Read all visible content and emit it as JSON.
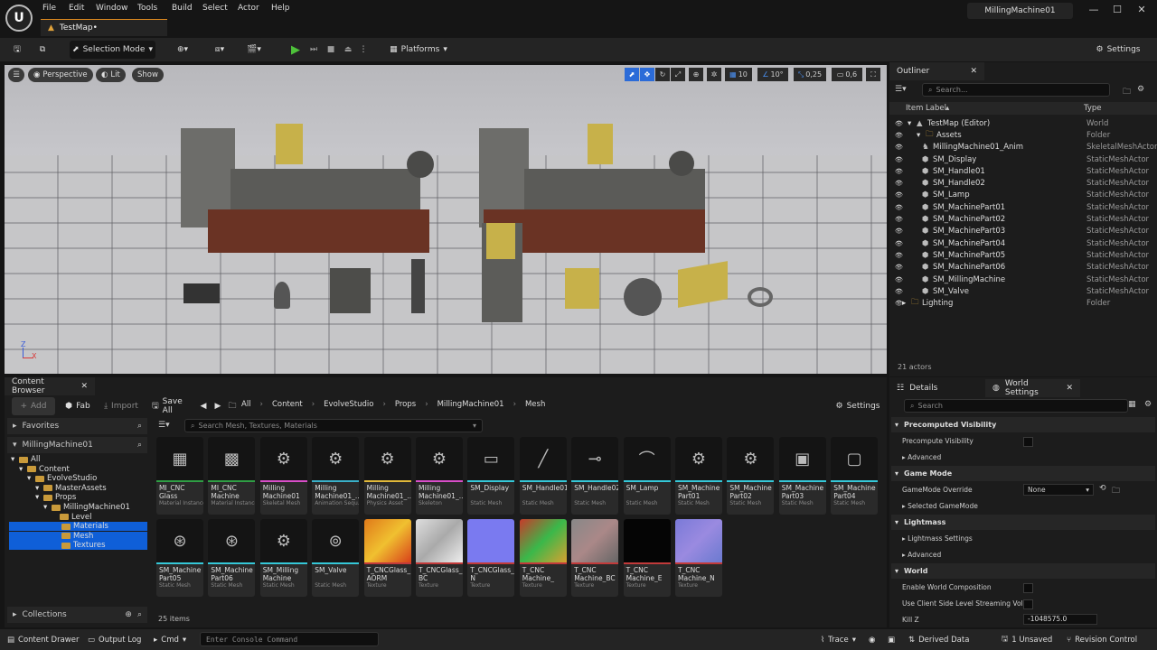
{
  "menu": [
    "File",
    "Edit",
    "Window",
    "Tools",
    "Build",
    "Select",
    "Actor",
    "Help"
  ],
  "tab_title": "TestMap•",
  "project_name": "MillingMachine01",
  "toolbar": {
    "selection_mode": "Selection Mode",
    "platforms": "Platforms",
    "settings": "Settings"
  },
  "viewport": {
    "perspective": "Perspective",
    "lit": "Lit",
    "show": "Show",
    "grid_snap": "10",
    "rot_snap": "10°",
    "scale_snap": "0,25",
    "cam_speed": "0,6",
    "axis_z": "Z",
    "axis_x": "X"
  },
  "outliner": {
    "title": "Outliner",
    "search_placeholder": "Search...",
    "col_label": "Item Label",
    "col_type": "Type",
    "rows": [
      {
        "label": "TestMap (Editor)",
        "type": "World"
      },
      {
        "label": "Assets",
        "type": "Folder"
      },
      {
        "label": "MillingMachine01_Anim",
        "type": "SkeletalMeshActor"
      },
      {
        "label": "SM_Display",
        "type": "StaticMeshActor"
      },
      {
        "label": "SM_Handle01",
        "type": "StaticMeshActor"
      },
      {
        "label": "SM_Handle02",
        "type": "StaticMeshActor"
      },
      {
        "label": "SM_Lamp",
        "type": "StaticMeshActor"
      },
      {
        "label": "SM_MachinePart01",
        "type": "StaticMeshActor"
      },
      {
        "label": "SM_MachinePart02",
        "type": "StaticMeshActor"
      },
      {
        "label": "SM_MachinePart03",
        "type": "StaticMeshActor"
      },
      {
        "label": "SM_MachinePart04",
        "type": "StaticMeshActor"
      },
      {
        "label": "SM_MachinePart05",
        "type": "StaticMeshActor"
      },
      {
        "label": "SM_MachinePart06",
        "type": "StaticMeshActor"
      },
      {
        "label": "SM_MillingMachine",
        "type": "StaticMeshActor"
      },
      {
        "label": "SM_Valve",
        "type": "StaticMeshActor"
      },
      {
        "label": "Lighting",
        "type": "Folder"
      }
    ],
    "count": "21 actors"
  },
  "content_browser": {
    "title": "Content Browser",
    "add": "Add",
    "fab": "Fab",
    "import": "Import",
    "save_all": "Save All",
    "breadcrumb": [
      "All",
      "Content",
      "EvolveStudio",
      "Props",
      "MillingMachine01",
      "Mesh"
    ],
    "settings": "Settings",
    "favorites": "Favorites",
    "root": "MillingMachine01",
    "tree": [
      "All",
      "Content",
      "EvolveStudio",
      "MasterAssets",
      "Props",
      "MillingMachine01",
      "Level",
      "Materials",
      "Mesh",
      "Textures"
    ],
    "collections": "Collections",
    "search_placeholder": "Search Mesh, Textures, Materials",
    "item_count": "25 items",
    "assets": [
      {
        "name": "MI_CNC Glass",
        "type": "Material Instance"
      },
      {
        "name": "MI_CNC Machine",
        "type": "Material Instance"
      },
      {
        "name": "Milling Machine01",
        "type": "Skeletal Mesh"
      },
      {
        "name": "Milling Machine01_...",
        "type": "Animation Sequ..."
      },
      {
        "name": "Milling Machine01_...",
        "type": "Physics Asset"
      },
      {
        "name": "Milling Machine01_...",
        "type": "Skeleton"
      },
      {
        "name": "SM_Display",
        "type": "Static Mesh"
      },
      {
        "name": "SM_Handle01",
        "type": "Static Mesh"
      },
      {
        "name": "SM_Handle02",
        "type": "Static Mesh"
      },
      {
        "name": "SM_Lamp",
        "type": "Static Mesh"
      },
      {
        "name": "SM_Machine Part01",
        "type": "Static Mesh"
      },
      {
        "name": "SM_Machine Part02",
        "type": "Static Mesh"
      },
      {
        "name": "SM_Machine Part03",
        "type": "Static Mesh"
      },
      {
        "name": "SM_Machine Part04",
        "type": "Static Mesh"
      },
      {
        "name": "SM_Machine Part05",
        "type": "Static Mesh"
      },
      {
        "name": "SM_Machine Part06",
        "type": "Static Mesh"
      },
      {
        "name": "SM_Milling Machine",
        "type": "Static Mesh"
      },
      {
        "name": "SM_Valve",
        "type": "Static Mesh"
      },
      {
        "name": "T_CNCGlass_ AORM",
        "type": "Texture"
      },
      {
        "name": "T_CNCGlass_ BC",
        "type": "Texture"
      },
      {
        "name": "T_CNCGlass_ N",
        "type": "Texture"
      },
      {
        "name": "T_CNC Machine_ AORM",
        "type": "Texture"
      },
      {
        "name": "T_CNC Machine_BC",
        "type": "Texture"
      },
      {
        "name": "T_CNC Machine_E",
        "type": "Texture"
      },
      {
        "name": "T_CNC Machine_N",
        "type": "Texture"
      }
    ]
  },
  "details": {
    "tab_details": "Details",
    "tab_world": "World Settings",
    "search_placeholder": "Search",
    "sec_precomputed": "Precomputed Visibility",
    "precompute_visibility": "Precompute Visibility",
    "advanced": "Advanced",
    "sec_gamemode": "Game Mode",
    "gamemode_override": "GameMode Override",
    "gamemode_value": "None",
    "selected_gamemode": "Selected GameMode",
    "sec_lightmass": "Lightmass",
    "lightmass_settings": "Lightmass Settings",
    "sec_world": "World",
    "enable_world_composition": "Enable World Composition",
    "client_side_streaming": "Use Client Side Level Streaming Vol...",
    "kill_z": "Kill Z",
    "kill_z_value": "-1048575.0"
  },
  "statusbar": {
    "content_drawer": "Content Drawer",
    "output_log": "Output Log",
    "cmd": "Cmd",
    "console_placeholder": "Enter Console Command",
    "trace": "Trace",
    "derived_data": "Derived Data",
    "unsaved": "1 Unsaved",
    "revision": "Revision Control"
  },
  "colors": {
    "accent_blue": "#2b6bd8",
    "mesh_bar": "#35c8d8",
    "material_bar": "#2f9e44",
    "texture_bar": "#c23a3a",
    "anim_bar": "#3ab0c8",
    "skel_bar": "#d84ec8",
    "phys_bar": "#e0b83a"
  }
}
